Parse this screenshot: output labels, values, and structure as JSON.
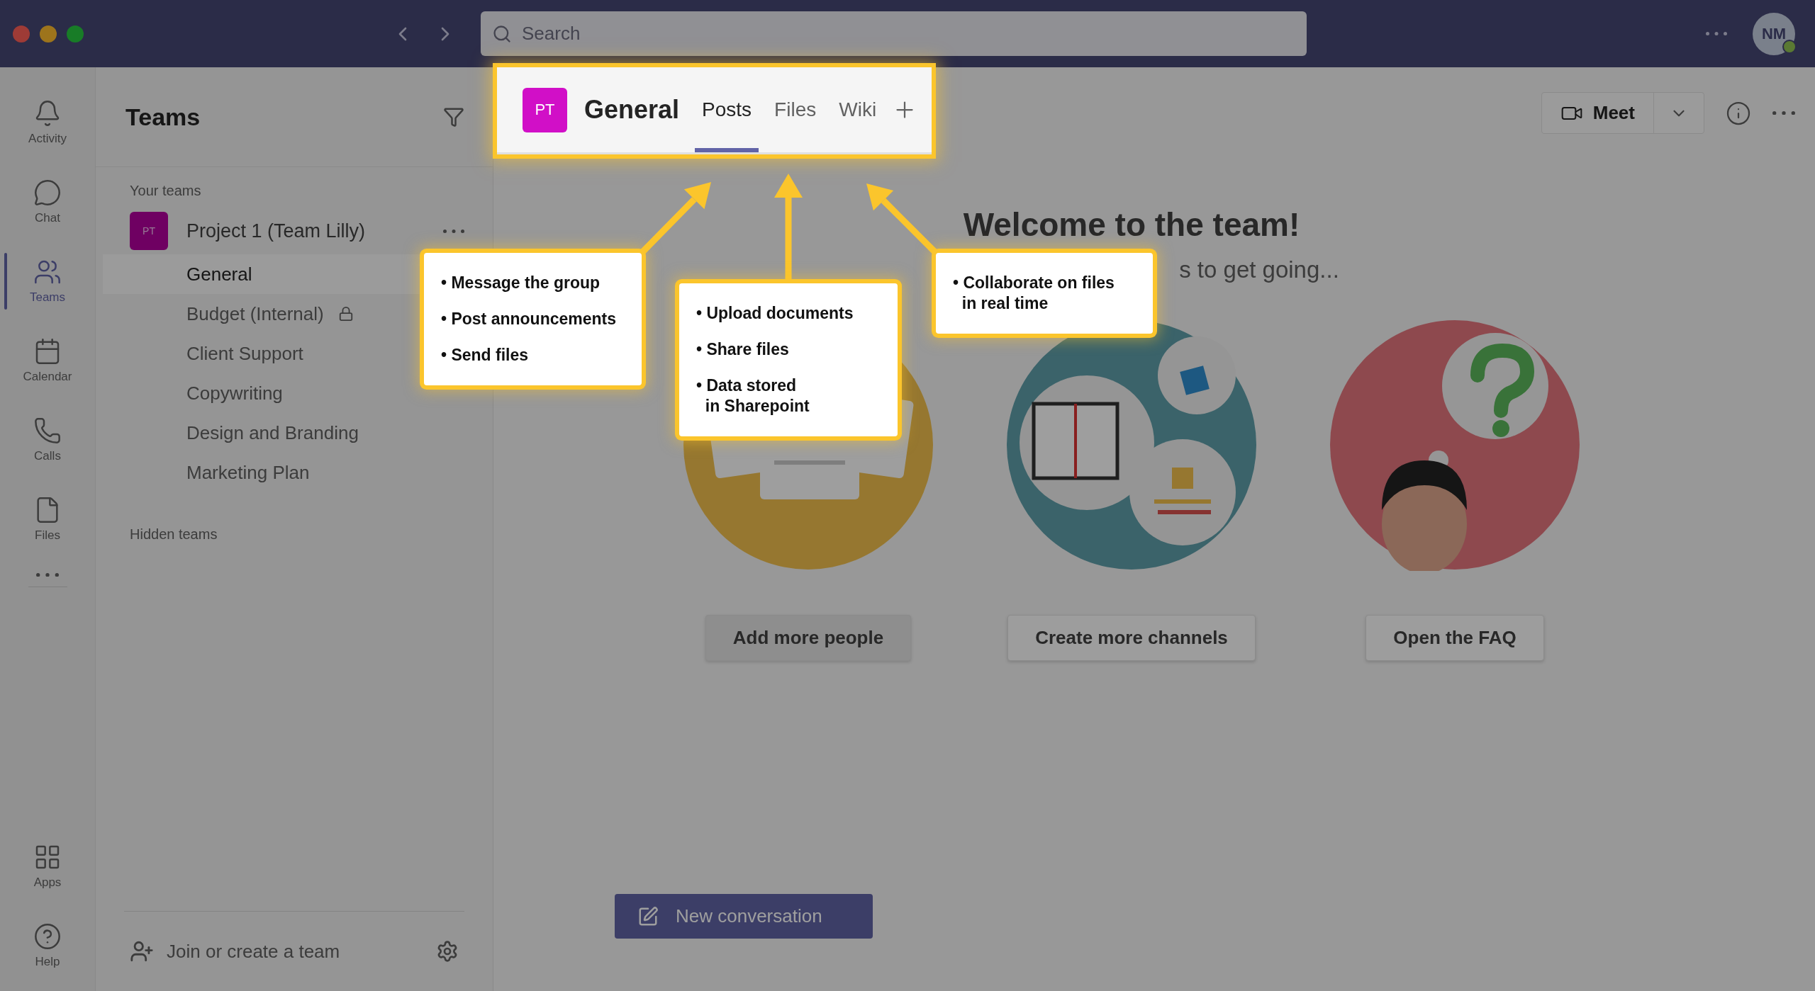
{
  "titlebar": {
    "search": {
      "placeholder": "Search"
    },
    "avatar": {
      "initials": "NM"
    }
  },
  "rail": {
    "items": [
      {
        "kind": "activity",
        "label": "Activity",
        "selected": false
      },
      {
        "kind": "chat",
        "label": "Chat",
        "selected": false
      },
      {
        "kind": "teams",
        "label": "Teams",
        "selected": true
      },
      {
        "kind": "calendar",
        "label": "Calendar",
        "selected": false
      },
      {
        "kind": "calls",
        "label": "Calls",
        "selected": false
      },
      {
        "kind": "files",
        "label": "Files",
        "selected": false
      }
    ],
    "bottom_items": [
      {
        "kind": "apps",
        "label": "Apps",
        "selected": false
      },
      {
        "kind": "help",
        "label": "Help",
        "selected": false
      }
    ]
  },
  "sidebar": {
    "title": "Teams",
    "section": "Your teams",
    "team": {
      "initials": "PT",
      "name": "Project 1 (Team Lilly)"
    },
    "channels": [
      {
        "name": "General",
        "selected": true,
        "private": false
      },
      {
        "name": "Budget (Internal)",
        "selected": false,
        "private": true
      },
      {
        "name": "Client Support",
        "selected": false,
        "private": false
      },
      {
        "name": "Copywriting",
        "selected": false,
        "private": false
      },
      {
        "name": "Design and Branding",
        "selected": false,
        "private": false
      },
      {
        "name": "Marketing Plan",
        "selected": false,
        "private": false
      }
    ],
    "hidden_section": "Hidden teams",
    "join": "Join or create a team"
  },
  "channel_header": {
    "initials": "PT",
    "name": "General",
    "tabs": [
      {
        "label": "Posts",
        "selected": true
      },
      {
        "label": "Files",
        "selected": false
      },
      {
        "label": "Wiki",
        "selected": false
      }
    ]
  },
  "meet": {
    "label": "Meet"
  },
  "welcome": {
    "title": "Welcome to the team!",
    "subtitle": "s to get going..."
  },
  "actions": [
    {
      "kind": "people",
      "label": "Add more people",
      "focused": true
    },
    {
      "kind": "channels",
      "label": "Create more channels",
      "focused": false
    },
    {
      "kind": "faq",
      "label": "Open the FAQ",
      "focused": false
    }
  ],
  "new_conversation": {
    "label": "New conversation"
  },
  "callouts": [
    {
      "items": [
        "• Message the group",
        "• Post announcements",
        "• Send files"
      ]
    },
    {
      "items": [
        "• Upload documents",
        "• Share files",
        "• Data stored\n  in Sharepoint"
      ]
    },
    {
      "items": [
        "• Collaborate on files\n  in real time"
      ]
    }
  ]
}
